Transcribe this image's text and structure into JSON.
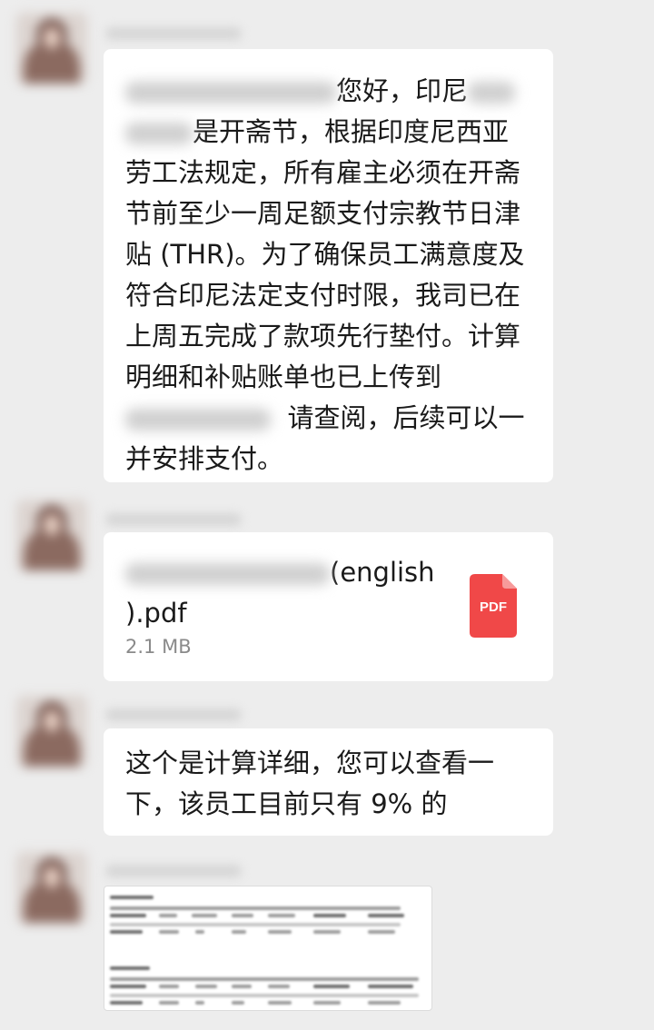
{
  "messages": [
    {
      "type": "text",
      "text_part1": "您好，印尼",
      "text_part2": "是开斋节，根据印度尼西亚劳工法规定，所有雇主必须在开斋节前至少一周足额支付宗教节日津贴 (THR)。为了确保员工满意度及符合印尼法定支付时限，我司已在上周五完成了款项先行垫付。计算明细和补贴账单也已上传到",
      "text_part3": "请查阅，后续可以一并安排支付。"
    },
    {
      "type": "file",
      "file_name_visible": "(english",
      "file_name_ext": ").pdf",
      "file_size": "2.1 MB",
      "icon_label": "PDF",
      "icon_color": "#f04848"
    },
    {
      "type": "text",
      "text": "这个是计算详细，您可以查看一下，该员工目前只有 9% 的"
    },
    {
      "type": "image",
      "icon": "spreadsheet-image"
    }
  ],
  "colors": {
    "background": "#ededed",
    "bubble": "#ffffff",
    "text": "#1a1a1a",
    "muted": "#8a8a8a",
    "pdf_red": "#f04848"
  }
}
